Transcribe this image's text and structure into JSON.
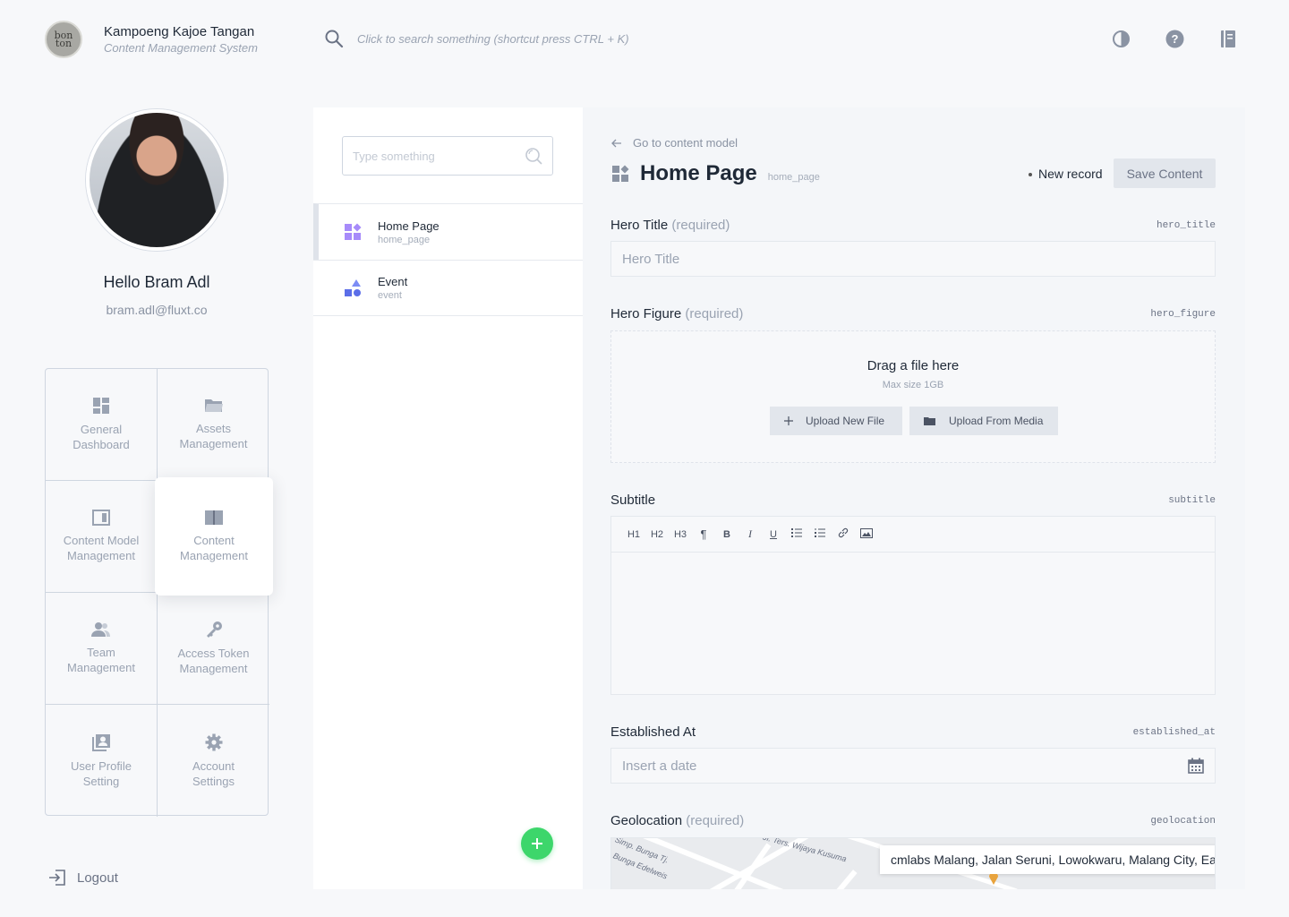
{
  "header": {
    "logo_text": "bon ton",
    "brand_title": "Kampoeng Kajoe Tangan",
    "brand_subtitle": "Content Management System",
    "search_hint": "Click to search something (shortcut press CTRL + K)"
  },
  "profile": {
    "greeting": "Hello Bram Adl",
    "email": "bram.adl@fluxt.co"
  },
  "menu": [
    {
      "line1": "General",
      "line2": "Dashboard",
      "icon": "dashboard-icon"
    },
    {
      "line1": "Assets",
      "line2": "Management",
      "icon": "folder-icon"
    },
    {
      "line1": "Content Model",
      "line2": "Management",
      "icon": "content-model-icon"
    },
    {
      "line1": "Content",
      "line2": "Management",
      "icon": "book-icon"
    },
    {
      "line1": "Team",
      "line2": "Management",
      "icon": "team-icon"
    },
    {
      "line1": "Access Token",
      "line2": "Management",
      "icon": "key-icon"
    },
    {
      "line1": "User Profile",
      "line2": "Setting",
      "icon": "user-profile-icon"
    },
    {
      "line1": "Account",
      "line2": "Settings",
      "icon": "gear-icon"
    }
  ],
  "logout_label": "Logout",
  "models": {
    "search_placeholder": "Type something",
    "items": [
      {
        "name": "Home Page",
        "key": "home_page"
      },
      {
        "name": "Event",
        "key": "event"
      }
    ]
  },
  "editor": {
    "back_label": "Go to content model",
    "title": "Home Page",
    "title_key": "home_page",
    "status": "New record",
    "save_label": "Save Content",
    "required_text": "(required)",
    "fields": {
      "hero_title": {
        "label": "Hero Title",
        "key": "hero_title",
        "placeholder": "Hero Title"
      },
      "hero_figure": {
        "label": "Hero Figure",
        "key": "hero_figure",
        "drop_title": "Drag a file here",
        "drop_sub": "Max size 1GB",
        "upload_new": "Upload New File",
        "upload_media": "Upload From Media"
      },
      "subtitle": {
        "label": "Subtitle",
        "key": "subtitle",
        "toolbar": [
          "H1",
          "H2",
          "H3",
          "¶",
          "B",
          "I",
          "U"
        ]
      },
      "established_at": {
        "label": "Established At",
        "key": "established_at",
        "placeholder": "Insert a date"
      },
      "geolocation": {
        "label": "Geolocation",
        "key": "geolocation",
        "address": "cmlabs Malang, Jalan Seruni, Lowokwaru, Malang City, East Java",
        "streets": [
          "Jl. Ters. Wijaya Kusuma",
          "Simp. Bunga Tj.",
          "Bunga Edelweis"
        ]
      }
    }
  }
}
